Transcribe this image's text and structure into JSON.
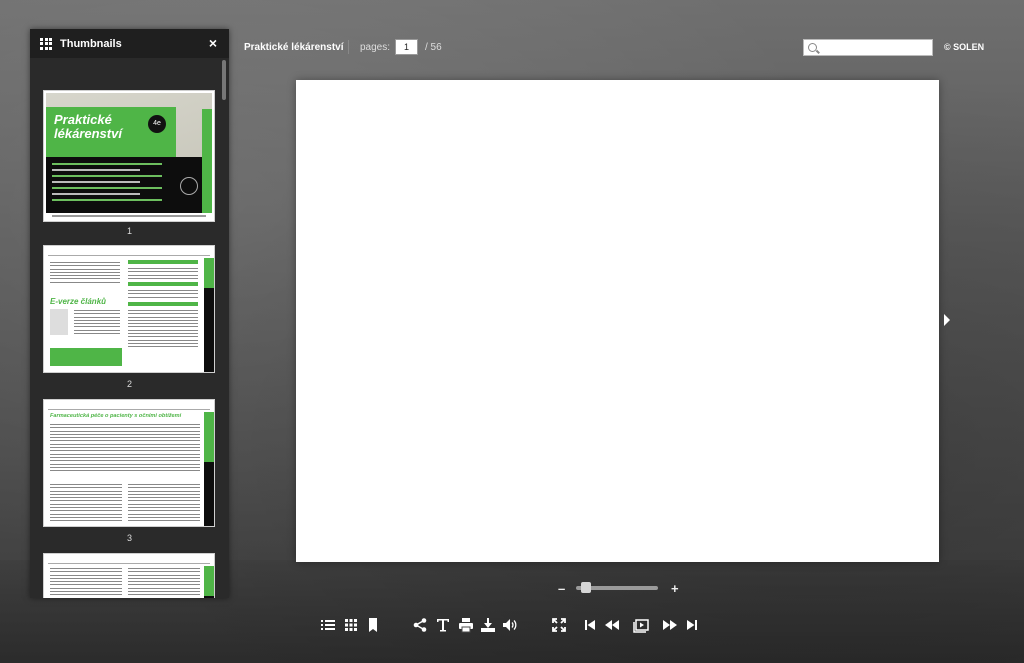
{
  "sidebar": {
    "title": "Thumbnails",
    "close_label": "×",
    "thumbnails": [
      {
        "number": "1",
        "cover_title_line1": "Praktické",
        "cover_title_line2": "lékárenství",
        "badge": "4e"
      },
      {
        "number": "2",
        "heading": "E-verze článků"
      },
      {
        "number": "3",
        "heading": "Farmaceutická péče o pacienty s očními obtížemi"
      },
      {
        "number": ""
      }
    ]
  },
  "header": {
    "doc_title": "Praktické lékárenství",
    "pages_label": "pages:",
    "current_page": "1",
    "total_pages": "/ 56",
    "search_placeholder": "",
    "copyright": "© SOLEN"
  },
  "zoom": {
    "minus": "–",
    "plus": "+",
    "level": 0.05
  },
  "toolbar": {
    "icons": [
      "list-icon",
      "grid-icon",
      "bookmark-icon",
      "share-icon",
      "text-icon",
      "print-icon",
      "download-icon",
      "sound-icon",
      "fullscreen-icon",
      "first-page-icon",
      "previous-page-icon",
      "slideshow-icon",
      "next-page-icon",
      "last-page-icon"
    ]
  },
  "colors": {
    "accent": "#4fb547",
    "sidebar": "#2a2a2a",
    "background": "#5a5a5a"
  }
}
